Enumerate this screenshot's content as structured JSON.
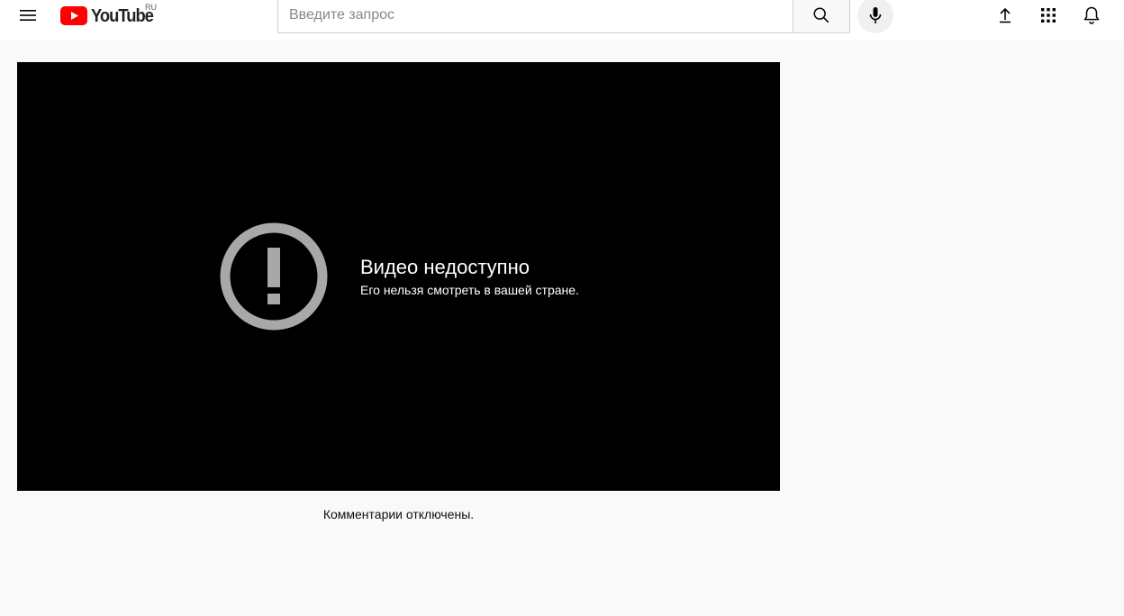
{
  "masthead": {
    "logo_text": "YouTube",
    "country_code": "RU",
    "search": {
      "placeholder": "Введите запрос",
      "value": ""
    },
    "icons": {
      "guide": "menu-icon",
      "search": "search-icon",
      "mic": "microphone-icon",
      "upload": "upload-icon",
      "apps": "apps-grid-icon",
      "notifications": "bell-icon"
    }
  },
  "player": {
    "error_title": "Видео недоступно",
    "error_subtitle": "Его нельзя смотреть в вашей стране.",
    "error_icon": "exclamation-circle-icon"
  },
  "comments": {
    "status_text": "Комментарии отключены."
  },
  "colors": {
    "brand_red": "#ff0000",
    "page_background": "#f9f9f9",
    "player_background": "#000000",
    "error_icon_color": "#a8a8a8"
  }
}
